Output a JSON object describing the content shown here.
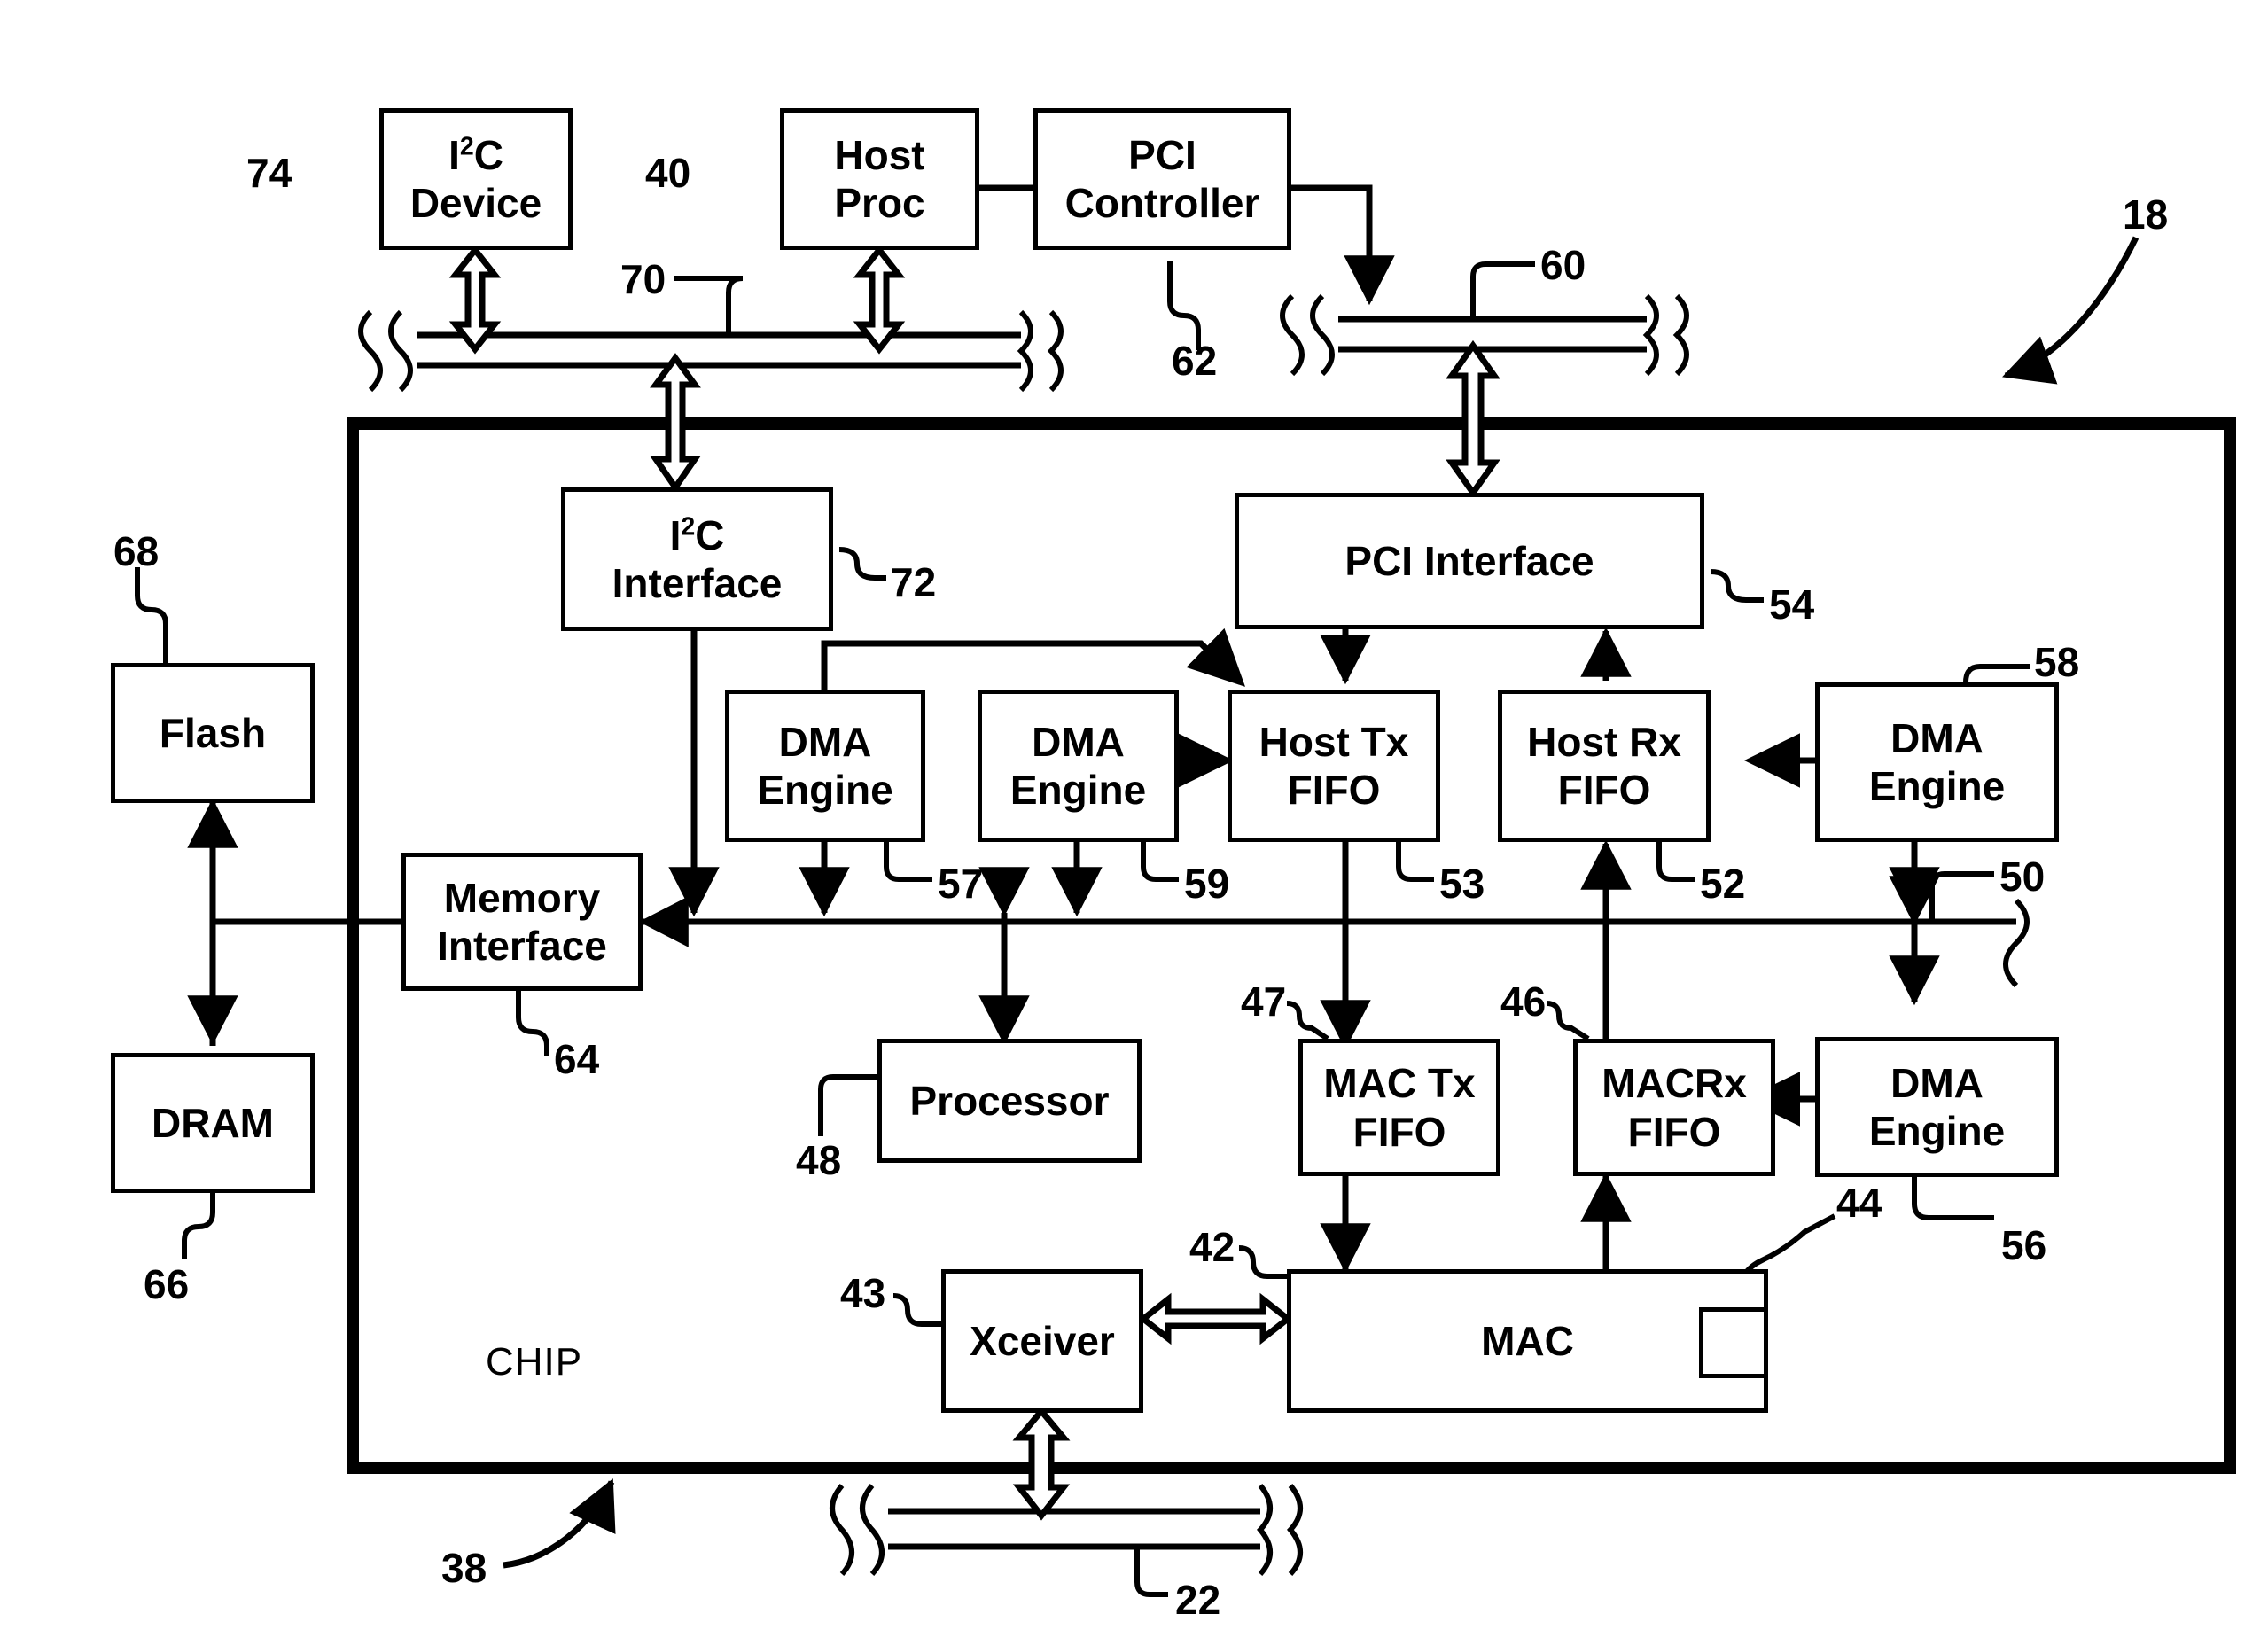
{
  "figure": {
    "chip_label": "CHIP",
    "boxes": [
      {
        "id": "i2c-device",
        "lines": [
          "I2C",
          "Device"
        ],
        "ref": "74"
      },
      {
        "id": "host-proc",
        "lines": [
          "Host",
          "Proc"
        ],
        "ref": "40"
      },
      {
        "id": "pci-controller",
        "lines": [
          "PCI",
          "Controller"
        ],
        "ref": "62"
      },
      {
        "id": "flash",
        "lines": [
          "Flash"
        ],
        "ref": "68"
      },
      {
        "id": "dram",
        "lines": [
          "DRAM"
        ],
        "ref": "66"
      },
      {
        "id": "i2c-interface",
        "lines": [
          "I2C",
          "Interface"
        ],
        "ref": "72"
      },
      {
        "id": "pci-interface",
        "lines": [
          "PCI Interface"
        ],
        "ref": "54"
      },
      {
        "id": "dma-engine-57",
        "lines": [
          "DMA",
          "Engine"
        ],
        "ref": "57"
      },
      {
        "id": "dma-engine-59",
        "lines": [
          "DMA",
          "Engine"
        ],
        "ref": "59"
      },
      {
        "id": "host-tx-fifo",
        "lines": [
          "Host Tx",
          "FIFO"
        ],
        "ref": "53"
      },
      {
        "id": "host-rx-fifo",
        "lines": [
          "Host Rx",
          "FIFO"
        ],
        "ref": "52"
      },
      {
        "id": "dma-engine-58",
        "lines": [
          "DMA",
          "Engine"
        ],
        "ref": "58"
      },
      {
        "id": "memory-interface",
        "lines": [
          "Memory",
          "Interface"
        ],
        "ref": "64"
      },
      {
        "id": "processor",
        "lines": [
          "Processor"
        ],
        "ref": "48"
      },
      {
        "id": "mac-tx-fifo",
        "lines": [
          "MAC Tx",
          "FIFO"
        ],
        "ref": "47"
      },
      {
        "id": "mac-rx-fifo",
        "lines": [
          "MACRx",
          "FIFO"
        ],
        "ref": "46"
      },
      {
        "id": "dma-engine-56",
        "lines": [
          "DMA",
          "Engine"
        ],
        "ref": "56"
      },
      {
        "id": "xceiver",
        "lines": [
          "Xceiver"
        ],
        "ref": "43"
      },
      {
        "id": "mac",
        "lines": [
          "MAC"
        ],
        "ref": "42"
      }
    ],
    "box_text": {
      "i2c_device_l1": "I",
      "i2c_device_sup": "2",
      "i2c_device_l1b": "C",
      "i2c_device_l2": "Device",
      "host_proc_l1": "Host",
      "host_proc_l2": "Proc",
      "pci_controller_l1": "PCI",
      "pci_controller_l2": "Controller",
      "flash": "Flash",
      "dram": "DRAM",
      "i2c_interface_l1": "I",
      "i2c_interface_sup": "2",
      "i2c_interface_l1b": "C",
      "i2c_interface_l2": "Interface",
      "pci_interface": "PCI Interface",
      "dma_engine_l1": "DMA",
      "dma_engine_l2": "Engine",
      "host_tx_l1": "Host Tx",
      "host_tx_l2": "FIFO",
      "host_rx_l1": "Host Rx",
      "host_rx_l2": "FIFO",
      "memory_interface_l1": "Memory",
      "memory_interface_l2": "Interface",
      "processor": "Processor",
      "mac_tx_l1": "MAC Tx",
      "mac_tx_l2": "FIFO",
      "mac_rx_l1": "MACRx",
      "mac_rx_l2": "FIFO",
      "xceiver": "Xceiver",
      "mac": "MAC"
    },
    "reference_numerals": {
      "r18": "18",
      "r22": "22",
      "r38": "38",
      "r40": "40",
      "r42": "42",
      "r43": "43",
      "r44": "44",
      "r46": "46",
      "r47": "47",
      "r48": "48",
      "r50": "50",
      "r52": "52",
      "r53": "53",
      "r54": "54",
      "r56": "56",
      "r57": "57",
      "r58": "58",
      "r59": "59",
      "r60": "60",
      "r62": "62",
      "r64": "64",
      "r66": "66",
      "r68": "68",
      "r70": "70",
      "r72": "72",
      "r74": "74"
    },
    "buses": [
      {
        "id": "bus-70",
        "ref": "70"
      },
      {
        "id": "bus-60",
        "ref": "60"
      },
      {
        "id": "bus-50",
        "ref": "50"
      },
      {
        "id": "bus-22",
        "ref": "22"
      }
    ],
    "colors": {
      "ink": "#000000",
      "paper": "#ffffff"
    }
  }
}
